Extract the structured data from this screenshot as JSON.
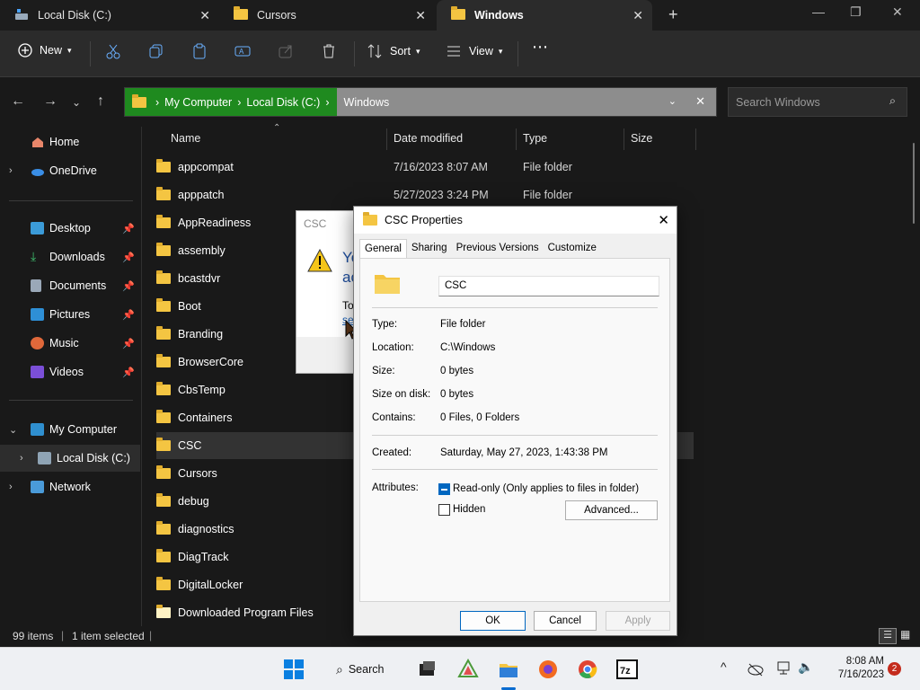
{
  "tabs": [
    {
      "label": "Local Disk (C:)"
    },
    {
      "label": "Cursors"
    },
    {
      "label": "Windows"
    }
  ],
  "toolbar": {
    "new_label": "New",
    "sort_label": "Sort",
    "view_label": "View"
  },
  "address": {
    "crumbs": [
      "My Computer",
      "Local Disk (C:)",
      "Windows"
    ]
  },
  "search": {
    "placeholder": "Search Windows"
  },
  "sidebar": {
    "home": "Home",
    "onedrive": "OneDrive",
    "quick": [
      "Desktop",
      "Downloads",
      "Documents",
      "Pictures",
      "Music",
      "Videos"
    ],
    "mycomputer": "My Computer",
    "localdisk": "Local Disk (C:)",
    "network": "Network"
  },
  "columns": {
    "name": "Name",
    "date": "Date modified",
    "type": "Type",
    "size": "Size"
  },
  "files": [
    {
      "name": "appcompat",
      "date": "7/16/2023 8:07 AM",
      "type": "File folder"
    },
    {
      "name": "apppatch",
      "date": "5/27/2023 3:24 PM",
      "type": "File folder"
    },
    {
      "name": "AppReadiness",
      "date": "",
      "type": ""
    },
    {
      "name": "assembly",
      "date": "",
      "type": ""
    },
    {
      "name": "bcastdvr",
      "date": "",
      "type": ""
    },
    {
      "name": "Boot",
      "date": "",
      "type": ""
    },
    {
      "name": "Branding",
      "date": "",
      "type": ""
    },
    {
      "name": "BrowserCore",
      "date": "",
      "type": ""
    },
    {
      "name": "CbsTemp",
      "date": "",
      "type": ""
    },
    {
      "name": "Containers",
      "date": "",
      "type": ""
    },
    {
      "name": "CSC",
      "date": "",
      "type": ""
    },
    {
      "name": "Cursors",
      "date": "",
      "type": ""
    },
    {
      "name": "debug",
      "date": "",
      "type": ""
    },
    {
      "name": "diagnostics",
      "date": "",
      "type": ""
    },
    {
      "name": "DiagTrack",
      "date": "",
      "type": ""
    },
    {
      "name": "DigitalLocker",
      "date": "",
      "type": ""
    },
    {
      "name": "Downloaded Program Files",
      "date": "",
      "type": ""
    }
  ],
  "status": {
    "items": "99 items",
    "selected": "1 item selected"
  },
  "bgdialog": {
    "title": "CSC",
    "text1": "Yo",
    "text2": "ac",
    "text3": "To",
    "text4": "se"
  },
  "props": {
    "title": "CSC Properties",
    "tabs": [
      "General",
      "Sharing",
      "Previous Versions",
      "Customize"
    ],
    "name_value": "CSC",
    "rows": [
      {
        "label": "Type:",
        "value": "File folder"
      },
      {
        "label": "Location:",
        "value": "C:\\Windows"
      },
      {
        "label": "Size:",
        "value": "0 bytes"
      },
      {
        "label": "Size on disk:",
        "value": "0 bytes"
      },
      {
        "label": "Contains:",
        "value": "0 Files, 0 Folders"
      }
    ],
    "created_label": "Created:",
    "created_value": "Saturday, May 27, 2023, 1:43:38 PM",
    "attributes_label": "Attributes:",
    "readonly_label": "Read-only (Only applies to files in folder)",
    "hidden_label": "Hidden",
    "advanced_label": "Advanced...",
    "ok": "OK",
    "cancel": "Cancel",
    "apply": "Apply"
  },
  "taskbar": {
    "search": "Search",
    "time": "8:08 AM",
    "date": "7/16/2023",
    "badge": "2"
  }
}
